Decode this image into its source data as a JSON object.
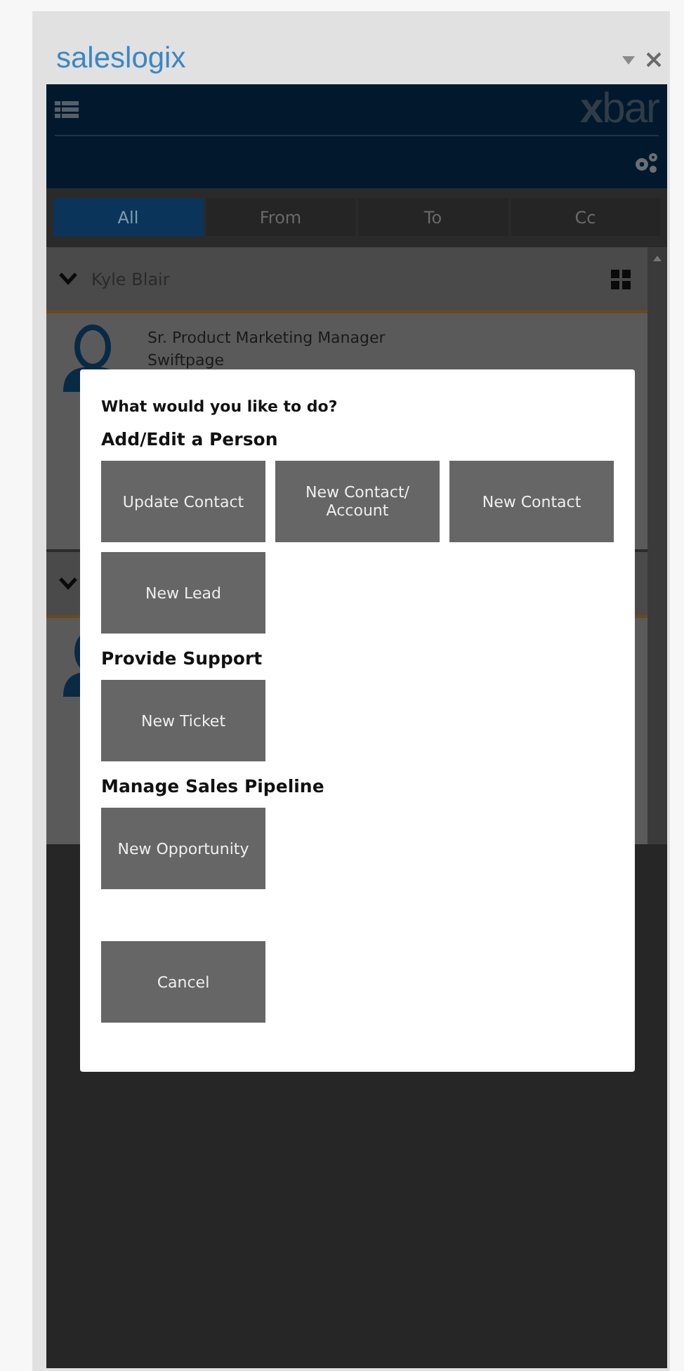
{
  "window": {
    "title": "saleslogix"
  },
  "header": {
    "logo": "**x**bar"
  },
  "tabs": [
    {
      "label": "All",
      "selected": true
    },
    {
      "label": "From",
      "selected": false
    },
    {
      "label": "To",
      "selected": false
    },
    {
      "label": "Cc",
      "selected": false
    }
  ],
  "contacts": [
    {
      "name": "Kyle Blair",
      "expanded": true,
      "title": "Sr. Product Marketing Manager",
      "company": "Swiftpage"
    },
    {
      "expanded": true
    }
  ],
  "dialog": {
    "prompt": "What would you like to do?",
    "sections": [
      {
        "heading": "Add/Edit a Person",
        "buttons": [
          "Update Contact",
          "New Contact/ Account",
          "New Contact",
          "New Lead"
        ]
      },
      {
        "heading": "Provide Support",
        "buttons": [
          "New Ticket"
        ]
      },
      {
        "heading": "Manage Sales Pipeline",
        "buttons": [
          "New Opportunity"
        ]
      }
    ],
    "cancel": "Cancel"
  }
}
